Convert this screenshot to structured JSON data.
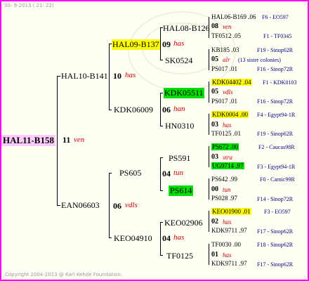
{
  "header": {
    "date_text": "30-  9-2013 ( 21: 22)"
  },
  "footer": {
    "copyright": "Copyright 2004-2013 @ Karl Kehde Foundation."
  },
  "colors": {
    "border": "#ff00ff",
    "highlight_yellow": "#ffff00",
    "highlight_green": "#00dd00",
    "root_pink": "#ffccff",
    "strain_red": "#cc0000",
    "info_blue": "#000080"
  },
  "root": {
    "id": "HAL11-B158",
    "gen": "11",
    "strain": "ven"
  },
  "gen1": {
    "upper": {
      "id": "HAL10-B141",
      "gen": "10",
      "strain": "has"
    },
    "lower": {
      "id": "EAN06603",
      "gen": "06",
      "strain": "vdls"
    }
  },
  "gen2": {
    "a": {
      "id": "HAL09-B137",
      "gen": "09",
      "strain": "has"
    },
    "b": {
      "id": "KDK06009",
      "gen": "06",
      "strain": "han"
    },
    "c": {
      "id": "PS605",
      "gen": "04",
      "strain": "tun"
    },
    "d": {
      "id": "KEO04910",
      "gen": "04",
      "strain": "has"
    }
  },
  "gen3": {
    "a1": "HAL08-B126",
    "a2": "SK0524",
    "b1": "KDK05511",
    "b2": "HN0310",
    "c1": "PS591",
    "c2": "PS614",
    "d1": "KEO02906",
    "d2": "TF0125"
  },
  "leaves": [
    {
      "top": "HAL06-B169 .06",
      "top_info": "F6 - EO597",
      "gen": "08",
      "strain": "ven",
      "note": "",
      "bottom": "TF0512 .05",
      "bottom_info": "F1 - TF0345"
    },
    {
      "top": "KB185 .03",
      "top_info": "F19 - Sinop62R",
      "gen": "05",
      "strain": "alr",
      "note": "(13 sister colonies)",
      "bottom": "PS017 .01",
      "bottom_info": "F16 - Sinop72R"
    },
    {
      "top": "KDK04402 .04",
      "top_info": "F1 - KDK0103",
      "gen": "05",
      "strain": "vdls",
      "note": "",
      "bottom": "PS017 .01",
      "bottom_info": "F16 - Sinop72R"
    },
    {
      "top": "KDK0004 .00",
      "top_info": "F4 - Egypt94-1R",
      "gen": "03",
      "strain": "has",
      "note": "",
      "bottom": "TF0125 .01",
      "bottom_info": "F19 - Sinop62R"
    },
    {
      "top": "PS672 .00",
      "top_info": "F2 - Caucas98R",
      "gen": "03",
      "strain": "stra",
      "note": "",
      "bottom": "UG9714 .97",
      "bottom_info": "F3 - Egypt94-1R"
    },
    {
      "top": "PS642 .99",
      "top_info": "F0 - Carnic99R",
      "gen": "00",
      "strain": "tun",
      "note": "",
      "bottom": "PS028 .97",
      "bottom_info": "F14 - Sinop72R"
    },
    {
      "top": "KEO01900 .01",
      "top_info": "F3 - EO597",
      "gen": "02",
      "strain": "has",
      "note": "",
      "bottom": "KDK9711 .97",
      "bottom_info": "F17 - Sinop62R"
    },
    {
      "top": "TF0030 .00",
      "top_info": "F18 - Sinop62R",
      "gen": "01",
      "strain": "has",
      "note": "",
      "bottom": "KDK9711 .97",
      "bottom_info": "F17 - Sinop62R"
    }
  ]
}
